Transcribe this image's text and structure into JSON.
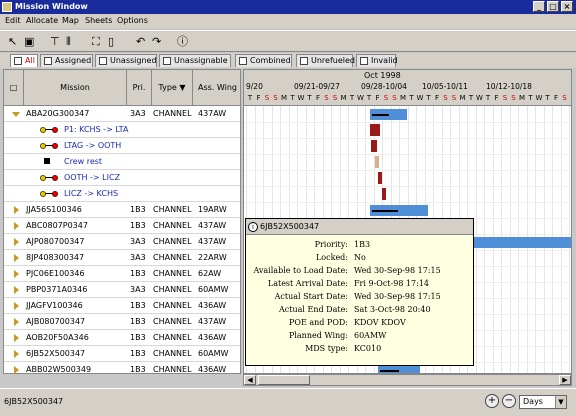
{
  "window": {
    "title": "Mission Window",
    "minimize": "_",
    "maximize": "□",
    "close": "×"
  },
  "menu": [
    "Edit",
    "Allocate",
    "Map",
    "Sheets",
    "Options"
  ],
  "toolbar": [
    "pointer-icon",
    "select-frame-icon",
    "hammer-icon",
    "columns-icon",
    "crop-icon",
    "document-icon",
    "undo-icon",
    "redo-icon",
    "info-icon"
  ],
  "tabs": [
    "All",
    "Assigned",
    "Unassigned",
    "Unassignable",
    "Combined",
    "Unrefueled",
    "Invalid"
  ],
  "columns": {
    "mission": "Mission",
    "pri": "Pri.",
    "type": "Type",
    "wing": "Ass. Wing"
  },
  "rows": [
    {
      "mission": "ABA20G300347",
      "pri": "3A3",
      "type": "CHANNEL",
      "wing": "437AW",
      "expanded": true
    },
    {
      "sub": "P1: KCHS -> LTA",
      "kind": "leg"
    },
    {
      "sub": "LTAG -> OOTH",
      "kind": "leg"
    },
    {
      "sub": "Crew rest",
      "kind": "rest"
    },
    {
      "sub": "OOTH -> LICZ",
      "kind": "leg"
    },
    {
      "sub": "LICZ -> KCHS",
      "kind": "leg"
    },
    {
      "mission": "JJA56S100346",
      "pri": "1B3",
      "type": "CHANNEL",
      "wing": "19ARW"
    },
    {
      "mission": "ABC0807P0347",
      "pri": "1B3",
      "type": "CHANNEL",
      "wing": "437AW"
    },
    {
      "mission": "AJP080700347",
      "pri": "3A3",
      "type": "CHANNEL",
      "wing": "437AW"
    },
    {
      "mission": "8JP408300347",
      "pri": "3A3",
      "type": "CHANNEL",
      "wing": "22ARW"
    },
    {
      "mission": "PJC06E100346",
      "pri": "1B3",
      "type": "CHANNEL",
      "wing": "62AW"
    },
    {
      "mission": "PBP0371A0346",
      "pri": "3A3",
      "type": "CHANNEL",
      "wing": "60AMW"
    },
    {
      "mission": "JJAGFV100346",
      "pri": "1B3",
      "type": "CHANNEL",
      "wing": "436AW"
    },
    {
      "mission": "AJB080700347",
      "pri": "1B3",
      "type": "CHANNEL",
      "wing": "437AW"
    },
    {
      "mission": "AOB20F50A346",
      "pri": "1B3",
      "type": "CHANNEL",
      "wing": "436AW"
    },
    {
      "mission": "6JB52X500347",
      "pri": "1B3",
      "type": "CHANNEL",
      "wing": "60AMW"
    },
    {
      "mission": "ABB02W500349",
      "pri": "1B3",
      "type": "CHANNEL",
      "wing": "436AW"
    }
  ],
  "gantt": {
    "month": "Oct 1998",
    "weeks": [
      "9/20",
      "09/21-09/27",
      "09/28-10/04",
      "10/05-10/11",
      "10/12-10/18"
    ],
    "days": [
      "T",
      "F",
      "S",
      "S",
      "M",
      "T",
      "W",
      "T",
      "F",
      "S",
      "S",
      "M",
      "T",
      "W",
      "T",
      "F",
      "S",
      "S",
      "M",
      "T",
      "W",
      "T",
      "F",
      "S",
      "S",
      "M",
      "T",
      "W",
      "T",
      "F",
      "S",
      "S",
      "M",
      "T",
      "W",
      "T",
      "F",
      "S",
      "S"
    ]
  },
  "tooltip": {
    "title": "6JB52X500347",
    "fields": [
      {
        "k": "Priority:",
        "v": "1B3"
      },
      {
        "k": "Locked:",
        "v": "No"
      },
      {
        "k": "Available to Load Date:",
        "v": "Wed 30-Sep-98 17:15"
      },
      {
        "k": "Latest Arrival Date:",
        "v": "Fri 9-Oct-98 17:14"
      },
      {
        "k": "Actual Start Date:",
        "v": "Wed 30-Sep-98 17:15"
      },
      {
        "k": "Actual End Date:",
        "v": "Sat 3-Oct-98 20:40"
      },
      {
        "k": "POE and POD:",
        "v": "KDOV KDOV"
      },
      {
        "k": "Planned Wing:",
        "v": "60AMW"
      },
      {
        "k": "MDS type:",
        "v": "KC010"
      }
    ]
  },
  "status": "6JB52X500347",
  "zoom_unit": "Days"
}
